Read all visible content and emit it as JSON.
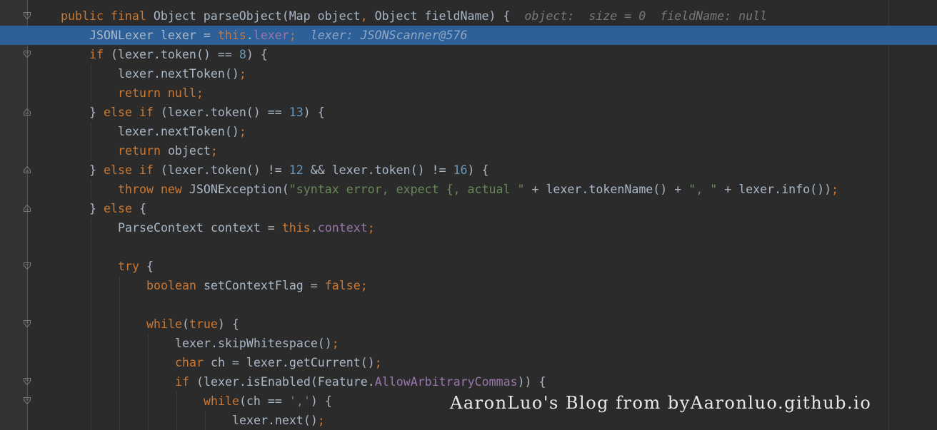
{
  "editor": {
    "language": "java",
    "colors": {
      "background": "#2b2b2b",
      "gutter": "#313335",
      "current_line": "#2d6099",
      "keyword": "#cc7832",
      "number": "#6897bb",
      "string": "#6a8759",
      "text": "#a9b7c6",
      "inline_hint": "#787878"
    },
    "lines": [
      {
        "indent": 0,
        "fold": "open",
        "current": false,
        "tokens": [
          {
            "t": "kw",
            "v": "public final "
          },
          {
            "t": "id",
            "v": "Object parseObject(Map object"
          },
          {
            "t": "kw",
            "v": ","
          },
          {
            "t": "id",
            "v": " Object fieldName) {  "
          },
          {
            "t": "hint",
            "v": "object:  size = 0  fieldName: null"
          }
        ]
      },
      {
        "indent": 1,
        "fold": "none",
        "current": true,
        "tokens": [
          {
            "t": "id",
            "v": "JSONLexer lexer = "
          },
          {
            "t": "kw",
            "v": "this"
          },
          {
            "t": "id",
            "v": "."
          },
          {
            "t": "fld",
            "v": "lexer"
          },
          {
            "t": "kw",
            "v": ";"
          },
          {
            "t": "id",
            "v": "  "
          },
          {
            "t": "hint",
            "v": "lexer: JSONScanner@576"
          }
        ]
      },
      {
        "indent": 1,
        "fold": "open",
        "current": false,
        "tokens": [
          {
            "t": "kw",
            "v": "if "
          },
          {
            "t": "id",
            "v": "(lexer.token() == "
          },
          {
            "t": "num",
            "v": "8"
          },
          {
            "t": "id",
            "v": ") {"
          }
        ]
      },
      {
        "indent": 2,
        "fold": "none",
        "current": false,
        "tokens": [
          {
            "t": "id",
            "v": "lexer.nextToken()"
          },
          {
            "t": "kw",
            "v": ";"
          }
        ]
      },
      {
        "indent": 2,
        "fold": "none",
        "current": false,
        "tokens": [
          {
            "t": "kw",
            "v": "return null;"
          }
        ]
      },
      {
        "indent": 1,
        "fold": "close",
        "current": false,
        "tokens": [
          {
            "t": "id",
            "v": "} "
          },
          {
            "t": "kw",
            "v": "else if "
          },
          {
            "t": "id",
            "v": "(lexer.token() == "
          },
          {
            "t": "num",
            "v": "13"
          },
          {
            "t": "id",
            "v": ") {"
          }
        ]
      },
      {
        "indent": 2,
        "fold": "none",
        "current": false,
        "tokens": [
          {
            "t": "id",
            "v": "lexer.nextToken()"
          },
          {
            "t": "kw",
            "v": ";"
          }
        ]
      },
      {
        "indent": 2,
        "fold": "none",
        "current": false,
        "tokens": [
          {
            "t": "kw",
            "v": "return "
          },
          {
            "t": "id",
            "v": "object"
          },
          {
            "t": "kw",
            "v": ";"
          }
        ]
      },
      {
        "indent": 1,
        "fold": "close",
        "current": false,
        "tokens": [
          {
            "t": "id",
            "v": "} "
          },
          {
            "t": "kw",
            "v": "else if "
          },
          {
            "t": "id",
            "v": "(lexer.token() != "
          },
          {
            "t": "num",
            "v": "12"
          },
          {
            "t": "id",
            "v": " && lexer.token() != "
          },
          {
            "t": "num",
            "v": "16"
          },
          {
            "t": "id",
            "v": ") {"
          }
        ]
      },
      {
        "indent": 2,
        "fold": "none",
        "current": false,
        "tokens": [
          {
            "t": "kw",
            "v": "throw new "
          },
          {
            "t": "id",
            "v": "JSONException("
          },
          {
            "t": "str",
            "v": "\"syntax error, expect {, actual \""
          },
          {
            "t": "id",
            "v": " + lexer.tokenName() + "
          },
          {
            "t": "str",
            "v": "\", \""
          },
          {
            "t": "id",
            "v": " + lexer.info())"
          },
          {
            "t": "kw",
            "v": ";"
          }
        ]
      },
      {
        "indent": 1,
        "fold": "close",
        "current": false,
        "tokens": [
          {
            "t": "id",
            "v": "} "
          },
          {
            "t": "kw",
            "v": "else "
          },
          {
            "t": "id",
            "v": "{"
          }
        ]
      },
      {
        "indent": 2,
        "fold": "none",
        "current": false,
        "tokens": [
          {
            "t": "id",
            "v": "ParseContext context = "
          },
          {
            "t": "kw",
            "v": "this"
          },
          {
            "t": "id",
            "v": "."
          },
          {
            "t": "fld",
            "v": "context"
          },
          {
            "t": "kw",
            "v": ";"
          }
        ]
      },
      {
        "indent": 0,
        "fold": "none",
        "current": false,
        "tokens": []
      },
      {
        "indent": 2,
        "fold": "open",
        "current": false,
        "tokens": [
          {
            "t": "kw",
            "v": "try "
          },
          {
            "t": "id",
            "v": "{"
          }
        ]
      },
      {
        "indent": 3,
        "fold": "none",
        "current": false,
        "tokens": [
          {
            "t": "kw",
            "v": "boolean "
          },
          {
            "t": "id",
            "v": "setContextFlag = "
          },
          {
            "t": "kw",
            "v": "false;"
          }
        ]
      },
      {
        "indent": 0,
        "fold": "none",
        "current": false,
        "tokens": []
      },
      {
        "indent": 3,
        "fold": "open",
        "current": false,
        "tokens": [
          {
            "t": "kw",
            "v": "while"
          },
          {
            "t": "id",
            "v": "("
          },
          {
            "t": "kw",
            "v": "true"
          },
          {
            "t": "id",
            "v": ") {"
          }
        ]
      },
      {
        "indent": 4,
        "fold": "none",
        "current": false,
        "tokens": [
          {
            "t": "id",
            "v": "lexer.skipWhitespace()"
          },
          {
            "t": "kw",
            "v": ";"
          }
        ]
      },
      {
        "indent": 4,
        "fold": "none",
        "current": false,
        "tokens": [
          {
            "t": "kw",
            "v": "char "
          },
          {
            "t": "id",
            "v": "ch = lexer.getCurrent()"
          },
          {
            "t": "kw",
            "v": ";"
          }
        ]
      },
      {
        "indent": 4,
        "fold": "open",
        "current": false,
        "tokens": [
          {
            "t": "kw",
            "v": "if "
          },
          {
            "t": "id",
            "v": "(lexer.isEnabled(Feature."
          },
          {
            "t": "fld",
            "v": "AllowArbitraryCommas"
          },
          {
            "t": "id",
            "v": ")) {"
          }
        ]
      },
      {
        "indent": 5,
        "fold": "open",
        "current": false,
        "tokens": [
          {
            "t": "kw",
            "v": "while"
          },
          {
            "t": "id",
            "v": "(ch == "
          },
          {
            "t": "str",
            "v": "','"
          },
          {
            "t": "id",
            "v": ") {"
          }
        ]
      },
      {
        "indent": 6,
        "fold": "none",
        "current": false,
        "tokens": [
          {
            "t": "id",
            "v": "lexer.next()"
          },
          {
            "t": "kw",
            "v": ";"
          }
        ]
      }
    ]
  },
  "watermark": {
    "text": "AaronLuo's Blog from byAaronluo.github.io"
  }
}
